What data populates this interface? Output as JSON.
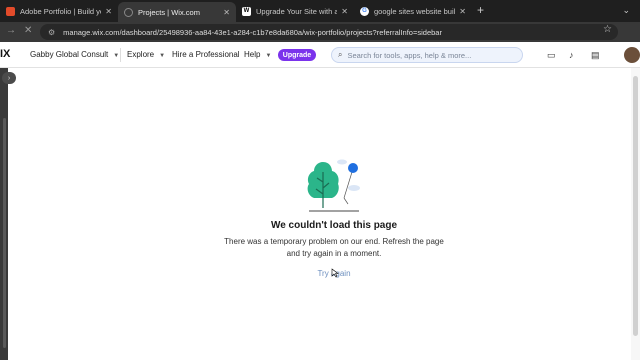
{
  "browser": {
    "tabs": [
      {
        "title": "Adobe Portfolio | Build your ow",
        "favicon": "Pf",
        "active": false
      },
      {
        "title": "Projects | Wix.com",
        "favicon": "",
        "active": true
      },
      {
        "title": "Upgrade Your Site with a Premi",
        "favicon": "Wx",
        "active": false
      },
      {
        "title": "google sites website builder - G",
        "favicon": "G",
        "active": false
      }
    ],
    "new_tab": "+",
    "tab_search": "⌄",
    "url": "manage.wix.com/dashboard/25498936-aa84-43e1-a284-c1b7e8da680a/wix-portfolio/projects?referralInfo=sidebar"
  },
  "app": {
    "logo": "IX",
    "site_name": "Gabby Global Consult",
    "menu": {
      "explore": "Explore",
      "hire": "Hire a Professional",
      "help": "Help"
    },
    "upgrade_label": "Upgrade",
    "search_placeholder": "Search for tools, apps, help & more..."
  },
  "error": {
    "title": "We couldn't load this page",
    "message": "There was a temporary problem on our end. Refresh the page and try again in a moment.",
    "retry_label": "Try again"
  },
  "colors": {
    "accent": "#7b33ec",
    "tree": "#2bb58a",
    "balloon": "#1f6fe0",
    "link": "#6d8fbf"
  }
}
